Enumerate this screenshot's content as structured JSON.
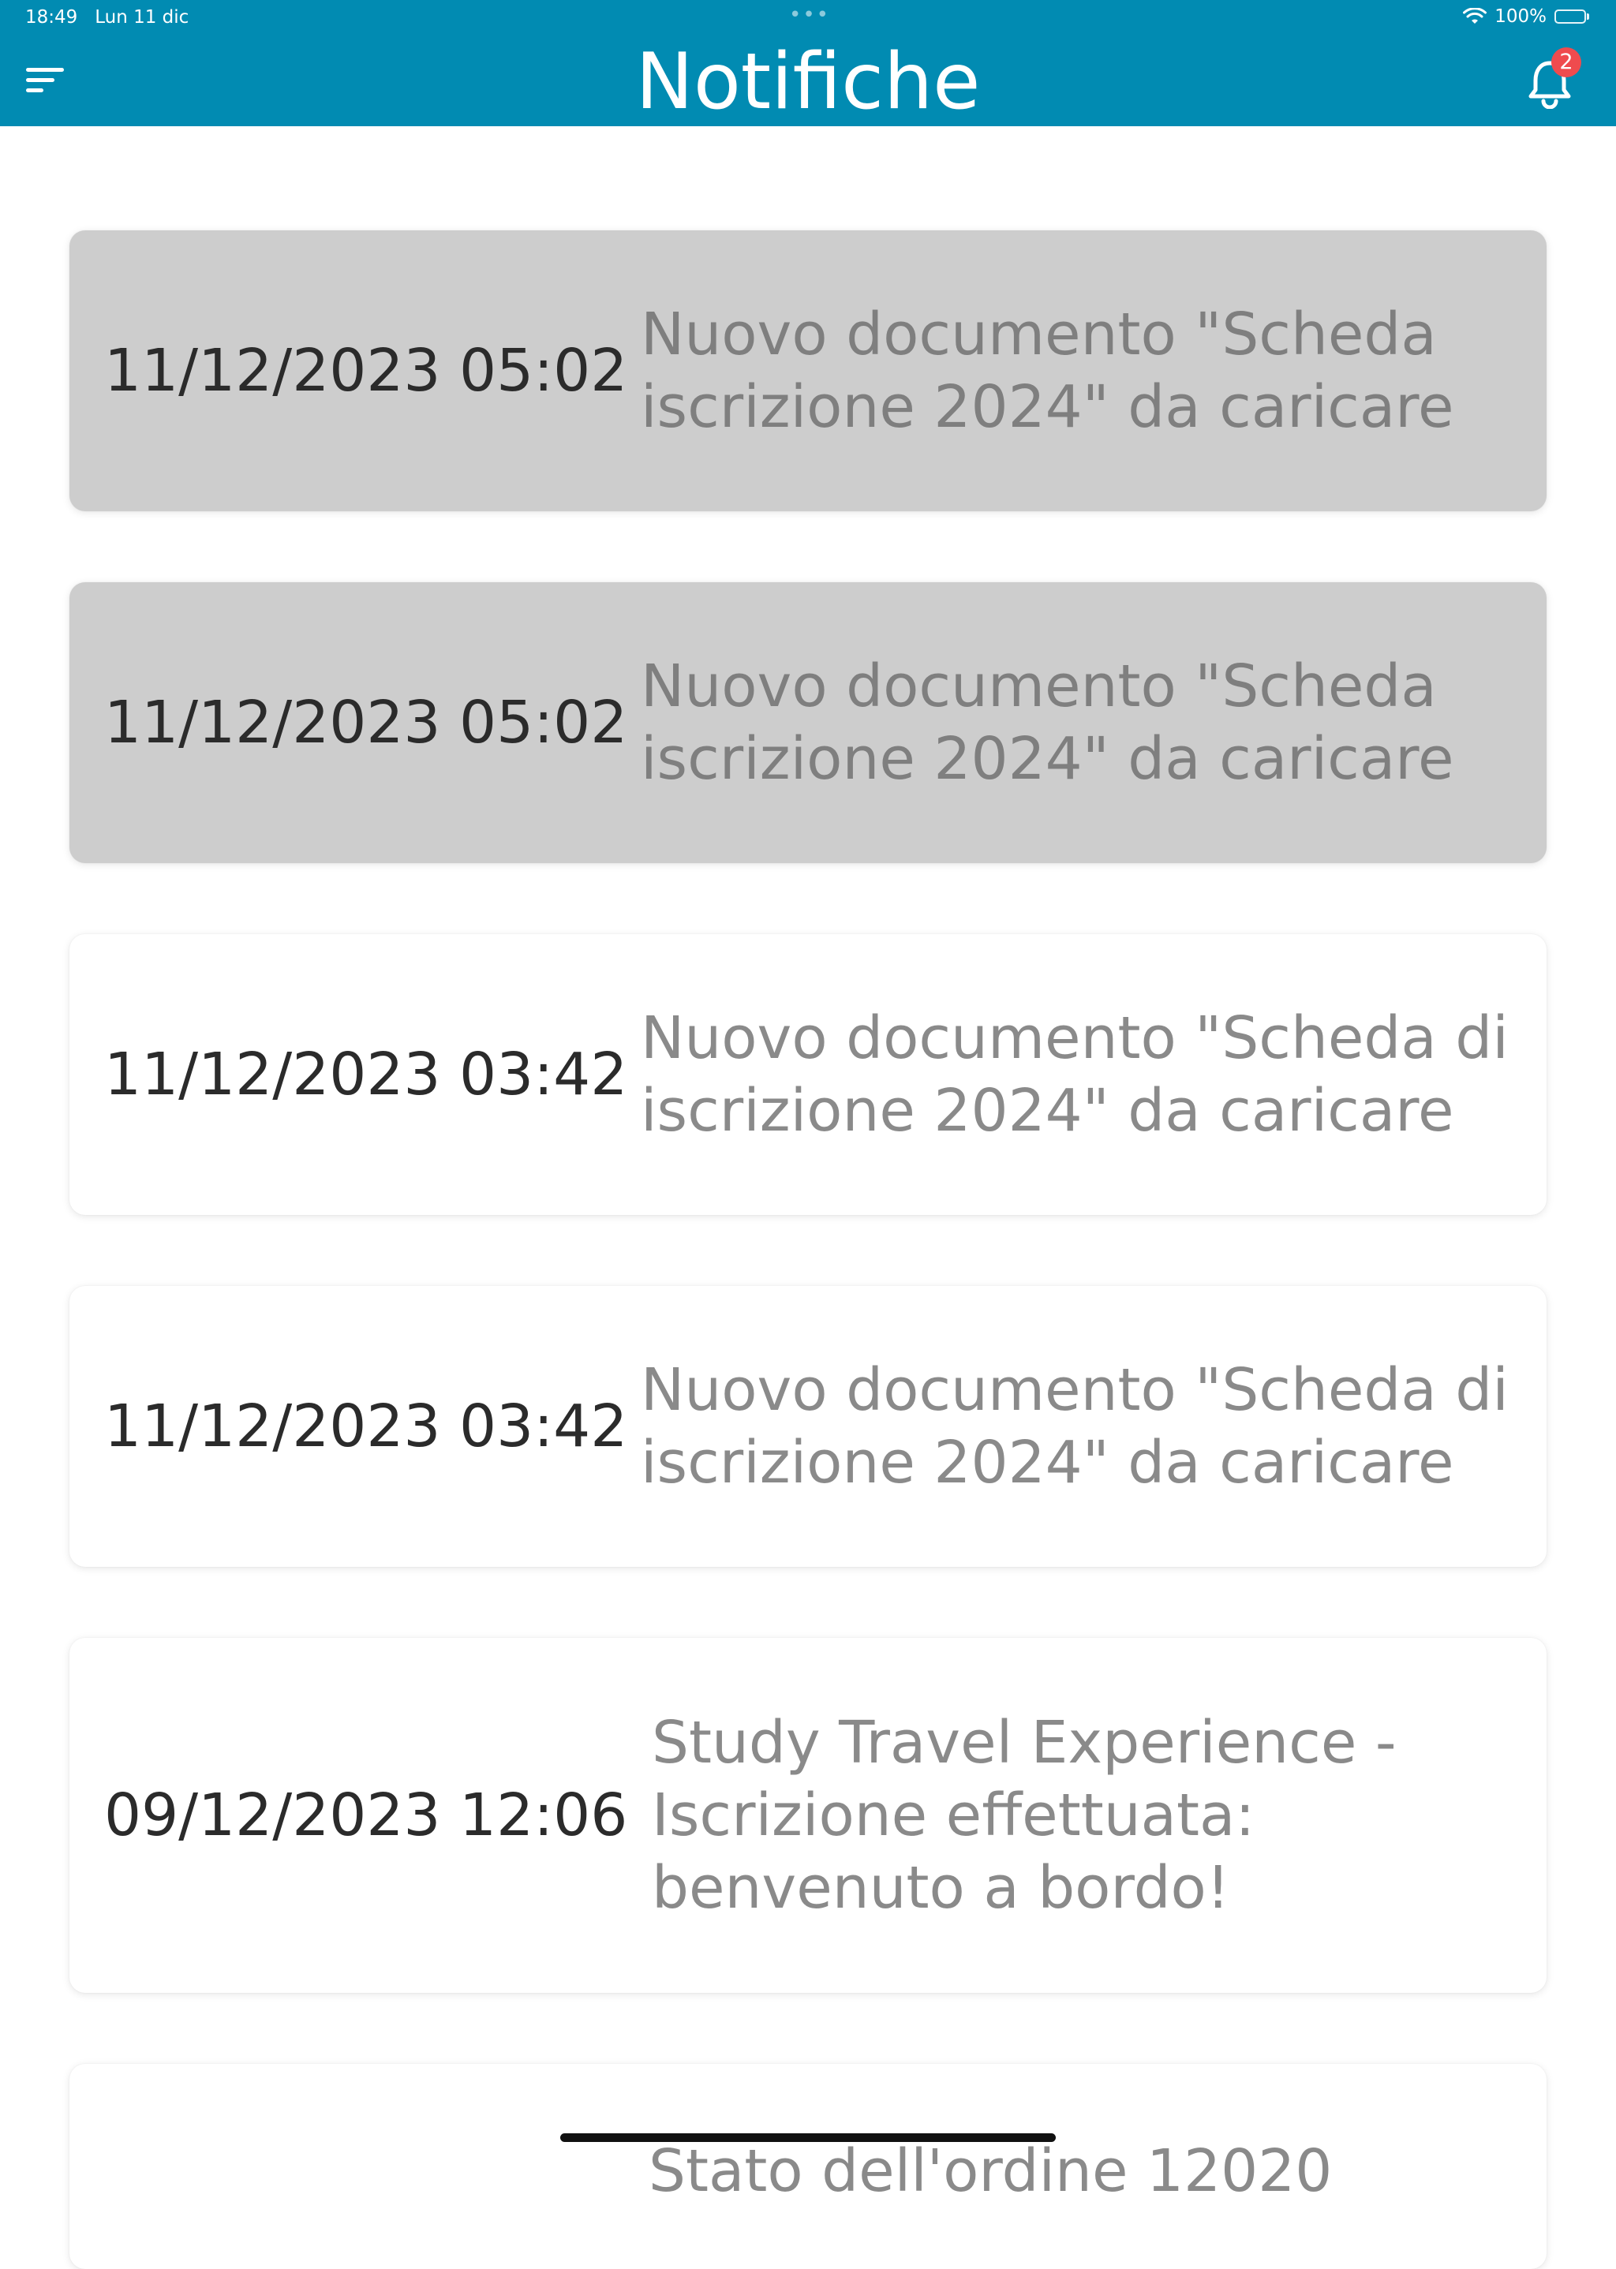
{
  "status_bar": {
    "time": "18:49",
    "date": "Lun 11 dic",
    "battery": "100%",
    "battery_level": 1.0
  },
  "header": {
    "title": "Notifiche",
    "menu_icon": "menu-lines-icon",
    "bell_icon": "bell-icon",
    "badge_count": "2",
    "color": "#018bb2"
  },
  "notifications": [
    {
      "date": "11/12/2023 05:02",
      "message": "Nuovo documento \"Scheda iscrizione 2024\" da caricare",
      "unread": true
    },
    {
      "date": "11/12/2023 05:02",
      "message": "Nuovo documento \"Scheda iscrizione 2024\" da caricare",
      "unread": true
    },
    {
      "date": "11/12/2023 03:42",
      "message": "Nuovo documento \"Scheda di iscrizione 2024\" da caricare",
      "unread": false
    },
    {
      "date": "11/12/2023 03:42",
      "message": "Nuovo documento \"Scheda di iscrizione 2024\" da caricare",
      "unread": false
    },
    {
      "date": "09/12/2023 12:06",
      "message": "Study Travel Experience - Iscrizione effettuata: benvenuto a bordo!",
      "unread": false
    },
    {
      "date": "",
      "message": "Stato dell'ordine 12020",
      "unread": false
    }
  ],
  "colors": {
    "unread_bg": "#cdcdcd",
    "read_bg": "#ffffff",
    "badge": "#ef4b4e"
  }
}
